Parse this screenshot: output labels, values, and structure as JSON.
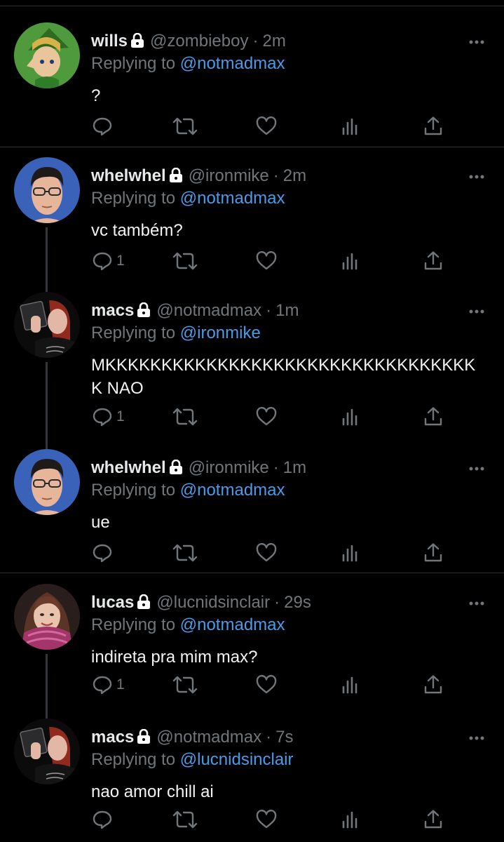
{
  "tweets": [
    {
      "name": "wills",
      "handle": "@zombieboy",
      "time": "2m",
      "reply_prefix": "Replying to",
      "reply_to": "@notmadmax",
      "text": "?",
      "reply_count": ""
    },
    {
      "name": "whelwhel",
      "handle": "@ironmike",
      "time": "2m",
      "reply_prefix": "Replying to",
      "reply_to": "@notmadmax",
      "text": "vc também?",
      "reply_count": "1"
    },
    {
      "name": "macs",
      "handle": "@notmadmax",
      "time": "1m",
      "reply_prefix": "Replying to",
      "reply_to": "@ironmike",
      "text": "MKKKKKKKKKKKKKKKKKKKKKKKKKKKKKKKKKK NAO",
      "reply_count": "1"
    },
    {
      "name": "whelwhel",
      "handle": "@ironmike",
      "time": "1m",
      "reply_prefix": "Replying to",
      "reply_to": "@notmadmax",
      "text": "ue",
      "reply_count": ""
    },
    {
      "name": "lucas",
      "handle": "@lucnidsinclair",
      "time": "29s",
      "reply_prefix": "Replying to",
      "reply_to": "@notmadmax",
      "text": "indireta pra mim max?",
      "reply_count": "1"
    },
    {
      "name": "macs",
      "handle": "@notmadmax",
      "time": "7s",
      "reply_prefix": "Replying to",
      "reply_to": "@lucnidsinclair",
      "text": "nao amor chill ai",
      "reply_count": ""
    }
  ],
  "separator": "·",
  "icons": {
    "reply": "reply-icon",
    "retweet": "retweet-icon",
    "like": "heart-icon",
    "views": "analytics-icon",
    "share": "share-icon",
    "lock": "lock-icon",
    "more": "more-icon"
  },
  "colors": {
    "background": "#000000",
    "text": "#e7e9ea",
    "muted": "#71767b",
    "link": "#4a9be8",
    "divider": "#2f3336"
  }
}
